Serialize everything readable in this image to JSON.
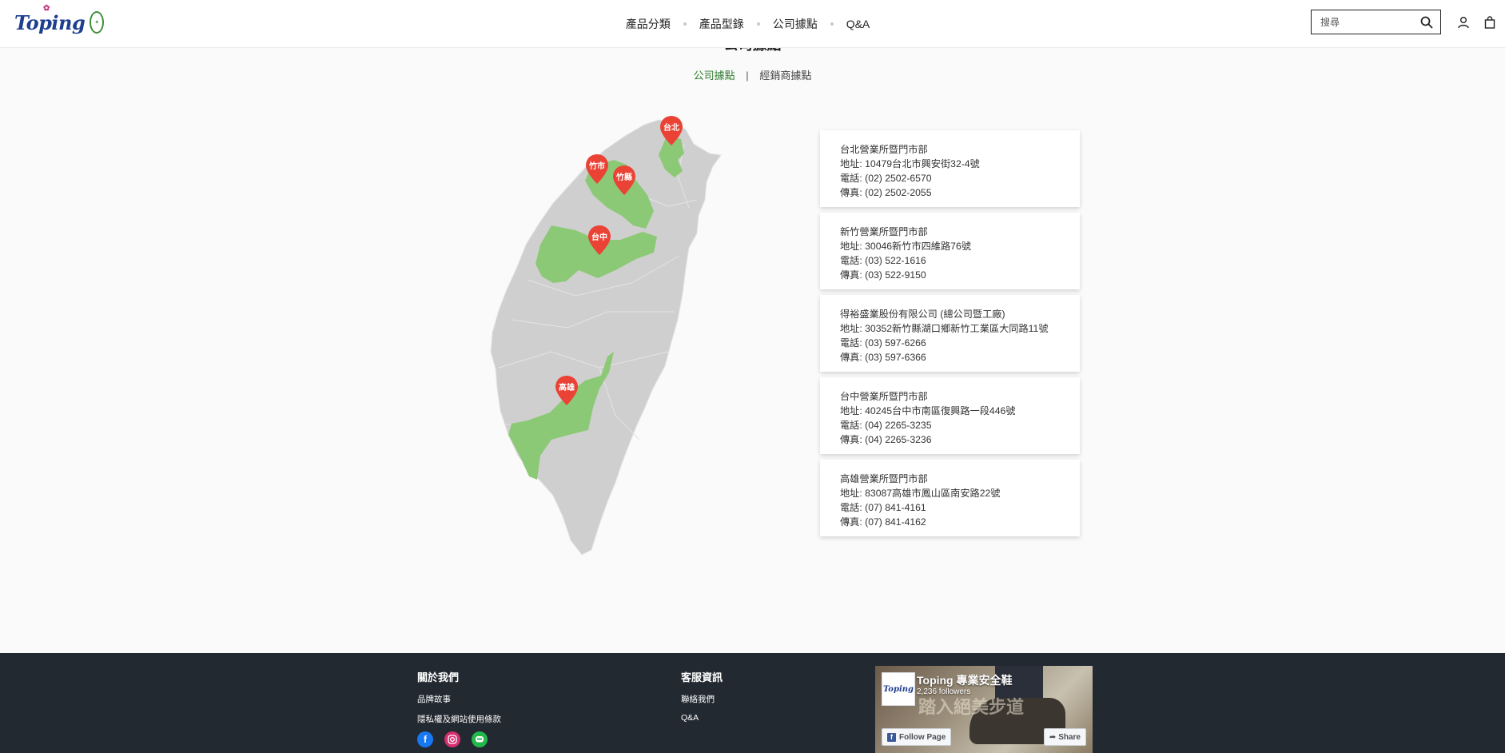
{
  "brand": {
    "logo_text": "Toping"
  },
  "nav": {
    "items": [
      {
        "label": "產品分類"
      },
      {
        "label": "產品型錄"
      },
      {
        "label": "公司據點"
      },
      {
        "label": "Q&A"
      }
    ]
  },
  "search": {
    "placeholder": "搜尋"
  },
  "page": {
    "title": "公司據點"
  },
  "tabs": {
    "active": "公司據點",
    "other": "經銷商據點"
  },
  "map": {
    "pins": [
      {
        "label": "台北"
      },
      {
        "label": "竹市"
      },
      {
        "label": "竹縣"
      },
      {
        "label": "台中"
      },
      {
        "label": "高雄"
      }
    ],
    "colors": {
      "land": "#cfcfcf",
      "highlight": "#8cc976",
      "pin": "#ea4335"
    }
  },
  "offices": [
    {
      "name": "台北營業所暨門市部",
      "address": "地址: 10479台北市興安街32-4號",
      "phone": "電話: (02) 2502-6570",
      "fax": "傳真: (02) 2502-2055"
    },
    {
      "name": "新竹營業所暨門市部",
      "address": "地址: 30046新竹市四維路76號",
      "phone": "電話: (03) 522-1616",
      "fax": "傳真: (03) 522-9150"
    },
    {
      "name": "得裕盛業股份有限公司 (總公司暨工廠)",
      "address": "地址: 30352新竹縣湖口鄉新竹工業區大同路11號",
      "phone": "電話: (03) 597-6266",
      "fax": "傳真: (03) 597-6366"
    },
    {
      "name": "台中營業所暨門市部",
      "address": "地址: 40245台中市南區復興路一段446號",
      "phone": "電話: (04) 2265-3235",
      "fax": "傳真: (04) 2265-3236"
    },
    {
      "name": "高雄營業所暨門市部",
      "address": "地址: 83087高雄市鳳山區南安路22號",
      "phone": "電話: (07) 841-4161",
      "fax": "傳真: (07) 841-4162"
    }
  ],
  "footer": {
    "about": {
      "heading": "關於我們",
      "links": [
        "品牌故事",
        "隱私權及網站使用條款"
      ]
    },
    "service": {
      "heading": "客服資訊",
      "links": [
        "聯絡我們",
        "Q&A"
      ]
    },
    "social": [
      "facebook-icon",
      "instagram-icon",
      "line-icon"
    ],
    "facebook": {
      "page_name": "Toping 專業安全鞋",
      "followers": "2,236 followers",
      "tagline": "踏入絕美步道",
      "follow_label": "Follow Page",
      "share_label": "Share",
      "avatar_text": "Toping"
    }
  }
}
